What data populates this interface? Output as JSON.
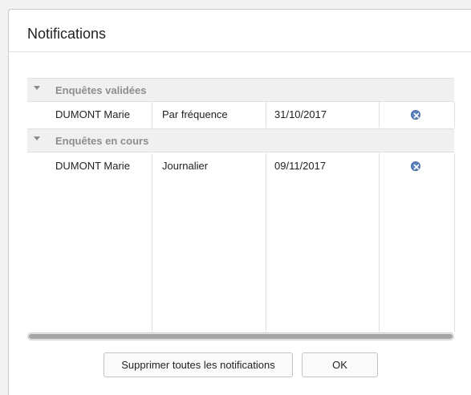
{
  "dialog": {
    "title": "Notifications"
  },
  "groups": [
    {
      "label": "Enquêtes validées",
      "rows": [
        {
          "name": "DUMONT Marie",
          "frequency": "Par fréquence",
          "date": "31/10/2017"
        }
      ]
    },
    {
      "label": "Enquêtes en cours",
      "rows": [
        {
          "name": "DUMONT Marie",
          "frequency": "Journalier",
          "date": "09/11/2017"
        }
      ]
    }
  ],
  "buttons": {
    "delete_all": "Supprimer toutes les notifications",
    "ok": "OK"
  },
  "icons": {
    "group_toggle": "caret-down-icon",
    "delete": "remove-circle-icon"
  },
  "colors": {
    "group_header_bg": "#f0f0f0",
    "group_header_text": "#8d8d8d",
    "delete_icon": "#5b83bd"
  }
}
